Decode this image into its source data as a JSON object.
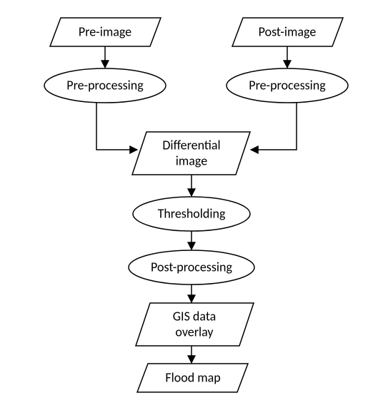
{
  "nodes": {
    "pre_image": {
      "label": "Pre-image"
    },
    "post_image": {
      "label": "Post-image"
    },
    "pre_proc_l": {
      "label": "Pre-processing"
    },
    "pre_proc_r": {
      "label": "Pre-processing"
    },
    "diff_image": {
      "label1": "Differential",
      "label2": "image"
    },
    "thresholding": {
      "label": "Thresholding"
    },
    "post_proc": {
      "label": "Post-processing"
    },
    "gis_overlay": {
      "label1": "GIS data",
      "label2": "overlay"
    },
    "flood_map": {
      "label": "Flood map"
    }
  }
}
